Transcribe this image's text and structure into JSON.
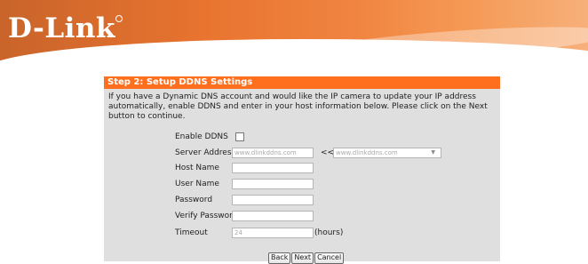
{
  "brand": {
    "logo_text": "D-Link"
  },
  "panel": {
    "title": "Step 2: Setup DDNS Settings",
    "description": "If you have a Dynamic DNS account and would like the IP camera to update your IP address automatically, enable DDNS and enter in your host information below. Please click on the Next button to continue."
  },
  "form": {
    "enable_ddns_label": "Enable DDNS",
    "enable_ddns_checked": false,
    "server_address_label": "Server Address",
    "server_address_placeholder": "www.dlinkddns.com",
    "server_select_sep": "<<",
    "server_select_value": "www.dlinkddns.com",
    "host_name_label": "Host Name",
    "user_name_label": "User Name",
    "password_label": "Password",
    "verify_password_label": "Verify Password",
    "timeout_label": "Timeout",
    "timeout_value": "24",
    "timeout_unit": "(hours)"
  },
  "buttons": {
    "back": "Back",
    "next": "Next",
    "cancel": "Cancel"
  },
  "colors": {
    "header_orange": "#e8742f",
    "title_bar": "#ff6f1e",
    "panel_bg": "#dfdfdf"
  }
}
